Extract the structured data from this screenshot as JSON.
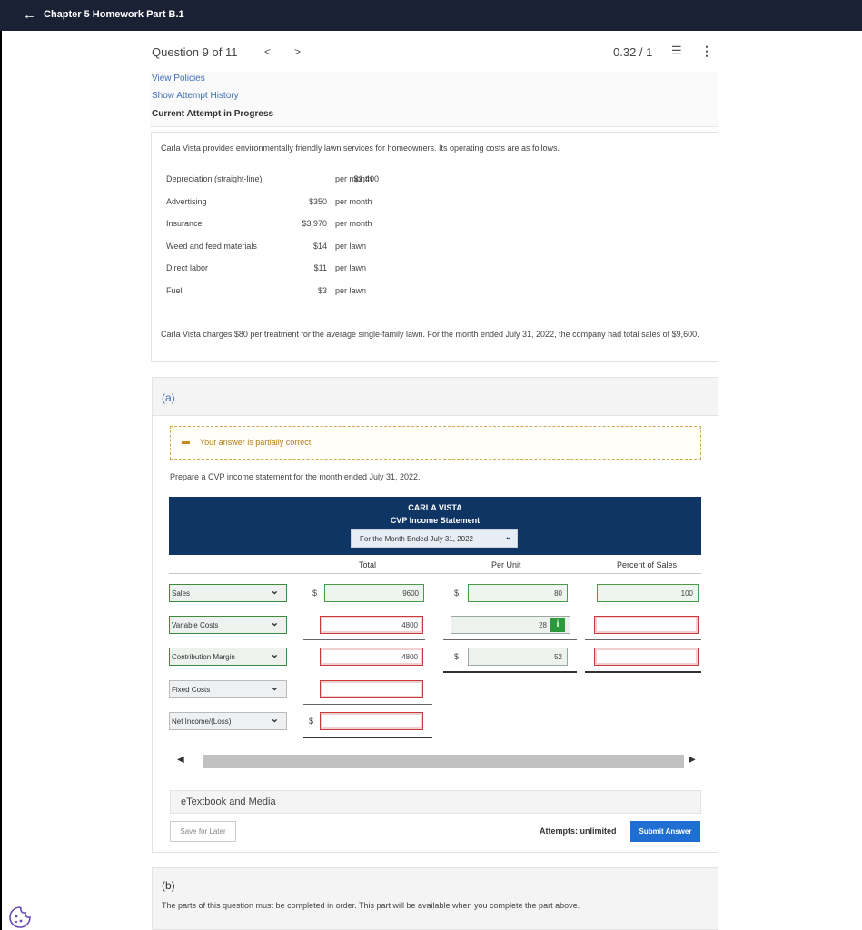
{
  "header": {
    "back_icon": "arrow-left-icon",
    "title": "Chapter 5 Homework Part B.1"
  },
  "question_nav": {
    "position": "Question 9 of 11",
    "prev": "<",
    "next": ">",
    "score": "0.32 / 1",
    "list_icon": "list-icon",
    "more_icon": "more-vertical-icon"
  },
  "links": {
    "view_policies": "View Policies",
    "show_history": "Show Attempt History",
    "current_attempt": "Current Attempt in Progress"
  },
  "problem": {
    "intro": "Carla Vista provides environmentally friendly lawn services for homeowners. Its operating costs are as follows.",
    "costs": [
      {
        "item": "Depreciation (straight-line)",
        "amount": "$1,400",
        "unit": "per month"
      },
      {
        "item": "Advertising",
        "amount": "$350",
        "unit": "per month"
      },
      {
        "item": "Insurance",
        "amount": "$3,970",
        "unit": "per month"
      },
      {
        "item": "Weed and feed materials",
        "amount": "$14",
        "unit": "per lawn"
      },
      {
        "item": "Direct labor",
        "amount": "$11",
        "unit": "per lawn"
      },
      {
        "item": "Fuel",
        "amount": "$3",
        "unit": "per lawn"
      }
    ],
    "charges": "Carla Vista charges $80 per treatment for the average single-family lawn. For the month ended July 31, 2022, the company had total sales of $9,600."
  },
  "part_a": {
    "label": "(a)",
    "feedback": "Your answer is partially correct.",
    "prompt": "Prepare a CVP income statement for the month ended July 31, 2022.",
    "statement": {
      "company": "CARLA VISTA",
      "title": "CVP Income Statement",
      "period": "For the Month Ended July 31, 2022"
    },
    "columns": {
      "total": "Total",
      "per_unit": "Per Unit",
      "percent": "Percent of Sales"
    },
    "rows": [
      {
        "label": "Sales",
        "total": "9600",
        "per_unit": "80",
        "percent": "100"
      },
      {
        "label": "Variable Costs",
        "total": "4800",
        "per_unit": "28",
        "percent": ""
      },
      {
        "label": "Contribution Margin",
        "total": "4800",
        "per_unit": "52",
        "percent": ""
      },
      {
        "label": "Fixed Costs",
        "total": ""
      },
      {
        "label": "Net Income/(Loss)",
        "total": ""
      }
    ],
    "dollar": "$",
    "info_badge": "i",
    "etextbook": "eTextbook and Media",
    "save_later": "Save for Later",
    "attempts": "Attempts: unlimited",
    "submit": "Submit Answer"
  },
  "part_b": {
    "label": "(b)",
    "note": "The parts of this question must be completed in order. This part will be available when you complete the part above."
  },
  "colors": {
    "header_bg": "#1b2135",
    "statement_bg": "#0f3564",
    "link": "#3d6fb5",
    "submit": "#1e6fd1",
    "correct_border": "#4a9a4a",
    "incorrect_border": "#c93a3a"
  }
}
